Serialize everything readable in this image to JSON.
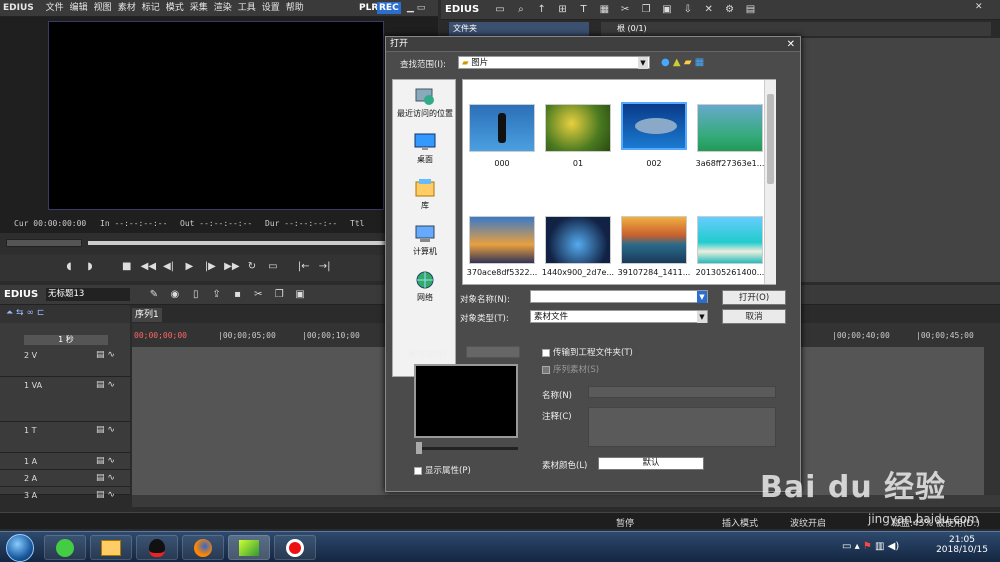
{
  "app": {
    "logo": "EDIUS",
    "menu": [
      "文件",
      "编辑",
      "视图",
      "素材",
      "标记",
      "模式",
      "采集",
      "渲染",
      "工具",
      "设置",
      "帮助"
    ],
    "plr": "PLR",
    "rec": "REC"
  },
  "player": {
    "cur": "Cur 00:00:00:00",
    "in": "In --:--:--:--",
    "out": "Out --:--:--:--",
    "dur": "Dur --:--:--:--",
    "ttl": "Ttl"
  },
  "bin": {
    "logo": "EDIUS",
    "folder_tab": "文件夹",
    "root_tab": "根 (0/1)"
  },
  "timeline": {
    "logo": "EDIUS",
    "project_name": "无标题13",
    "seq_tab": "序列1",
    "zoom": "1 秒",
    "ruler": [
      "00;00;00;00",
      "|00;00;05;00",
      "|00;00;10;00",
      "|00;00;40;00",
      "|00;00;45;00"
    ],
    "tracks": [
      {
        "name": "2 V"
      },
      {
        "name": "1 VA"
      },
      {
        "name": "1 T"
      },
      {
        "name": "1 A"
      },
      {
        "name": "2 A"
      },
      {
        "name": "3 A"
      }
    ]
  },
  "status": {
    "pause": "暂停",
    "insert": "插入模式",
    "wave": "波纹开启",
    "disk": "磁盘:45% 被使用(D:)"
  },
  "dialog": {
    "title": "打开",
    "look_in_label": "查找范围(I):",
    "look_in_value": "图片",
    "places": [
      "最近访问的位置",
      "桌面",
      "库",
      "计算机",
      "网络"
    ],
    "files": [
      {
        "name": "000"
      },
      {
        "name": "01"
      },
      {
        "name": "002"
      },
      {
        "name": "3a68ff27363e1..."
      },
      {
        "name": "370ace8df5322..."
      },
      {
        "name": "1440x900_2d7e..."
      },
      {
        "name": "39107284_1411..."
      },
      {
        "name": "201305261400..."
      }
    ],
    "object_name_label": "对象名称(N):",
    "object_name_value": "",
    "object_type_label": "对象类型(T):",
    "object_type_value": "素材文件",
    "open_button": "打开(O)",
    "cancel_button": "取消",
    "preview_label": "表现轴(R)",
    "show_props": "显示属性(P)",
    "copy_to_project": "传输到工程文件夹(T)",
    "seq_clip": "序列素材(S)",
    "name_label": "名称(N)",
    "comment_label": "注释(C)",
    "color_label": "素材颜色(L)",
    "color_value": "默认"
  },
  "taskbar": {
    "time": "21:05",
    "date": "2018/10/15"
  },
  "watermark": {
    "brand": "Bai du 经验",
    "url": "jingyan.baidu.com"
  }
}
